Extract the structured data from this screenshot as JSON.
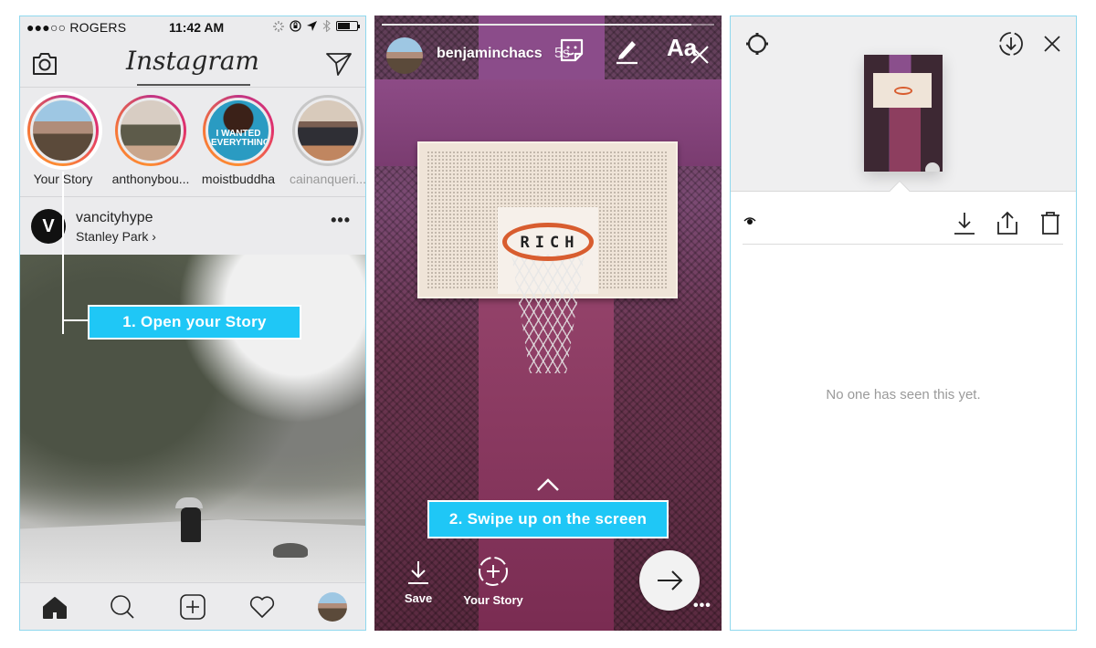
{
  "colors": {
    "callout_bg": "#1fc7f6",
    "panel_border": "#8fd8ee",
    "story_ring_gradient": [
      "#c13584",
      "#e1306c",
      "#fd8d32"
    ]
  },
  "panel1": {
    "status_bar": {
      "carrier": "●●●○○ ROGERS",
      "time": "11:42 AM",
      "battery_level_percent": 68
    },
    "header": {
      "logo": "Instagram",
      "camera_icon": "camera-icon",
      "direct_icon": "paper-plane-icon"
    },
    "stories": [
      {
        "label": "Your Story",
        "seen": false
      },
      {
        "label": "anthonybou...",
        "seen": false
      },
      {
        "label": "moistbuddha",
        "seen": false,
        "overlay_text": "I WANTED EVERYTHING"
      },
      {
        "label": "cainanqueri...",
        "seen": true
      }
    ],
    "post": {
      "avatar_letter": "V",
      "username": "vancityhype",
      "location": "Stanley Park ›",
      "more": "•••"
    },
    "callout": "1. Open your Story",
    "tab_bar": [
      "home-icon",
      "search-icon",
      "new-post-icon",
      "activity-heart-icon",
      "profile-avatar"
    ]
  },
  "panel2": {
    "progress_fraction": 0.93,
    "username": "benjaminchacs",
    "age": "5s",
    "tools": [
      "sticker-icon",
      "pen-icon",
      "text-tool"
    ],
    "text_tool_label": "Aa",
    "backboard_text": "RICH",
    "callout": "2. Swipe up on the screen",
    "actions": {
      "save": "Save",
      "your_story": "Your Story"
    },
    "more": "•••"
  },
  "panel3": {
    "top_icons": [
      "settings-gear-icon",
      "save-circle-icon",
      "close-icon"
    ],
    "actions": [
      "download-icon",
      "share-icon",
      "trash-icon"
    ],
    "viewer_count_icon": "eye-icon",
    "empty_message": "No one has seen this yet."
  }
}
